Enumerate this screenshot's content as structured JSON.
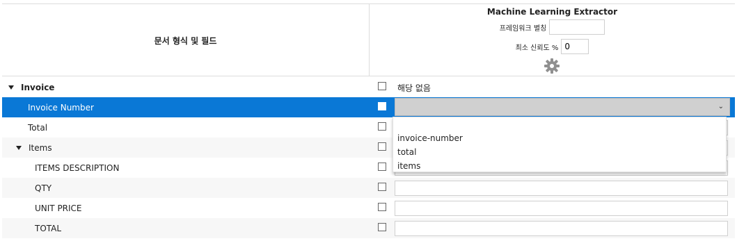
{
  "header": {
    "left_title": "문서 형식 및 필드",
    "ml_title": "Machine Learning Extractor",
    "framework_alias_label": "프레임워크 별칭",
    "framework_alias_value": "",
    "min_confidence_label": "최소 신뢰도 %",
    "min_confidence_value": "0",
    "settings_icon": "gear-icon"
  },
  "rows": [
    {
      "label": "Invoice",
      "bold": true,
      "expanded": true,
      "checkbox_label": "해당 없음"
    },
    {
      "label": "Invoice Number",
      "selected": true
    },
    {
      "label": "Total"
    },
    {
      "label": "Items",
      "expanded": true
    },
    {
      "label": "ITEMS DESCRIPTION"
    },
    {
      "label": "QTY"
    },
    {
      "label": "UNIT PRICE"
    },
    {
      "label": "TOTAL"
    }
  ],
  "dropdown": {
    "options": [
      "invoice-number",
      "total",
      "items"
    ]
  },
  "colors": {
    "selected_row": "#0a78d6",
    "border": "#dcdcdc",
    "gear": "#909090"
  }
}
